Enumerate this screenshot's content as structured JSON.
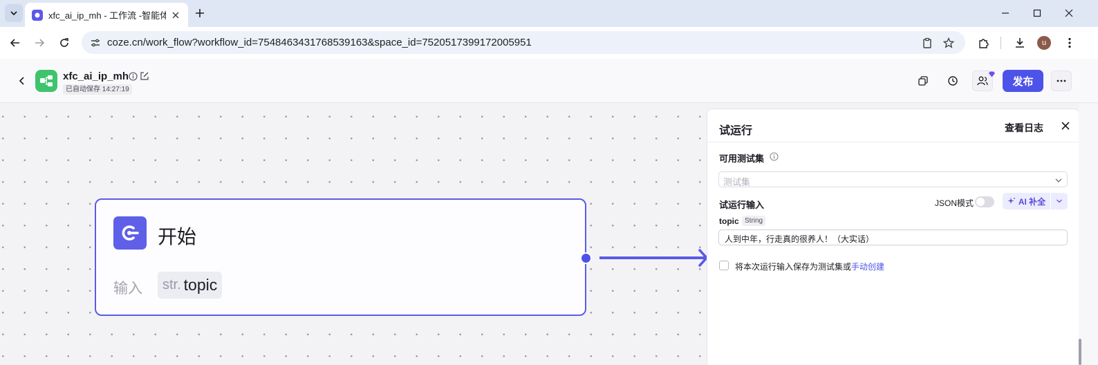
{
  "browser": {
    "tab_title": "xfc_ai_ip_mh - 工作流 -智能体",
    "url": "coze.cn/work_flow?workflow_id=7548463431768539163&space_id=7520517399172005951",
    "avatar_letter": "u"
  },
  "header": {
    "workflow_name": "xfc_ai_ip_mh",
    "autosave": "已自动保存 14:27:19",
    "publish_label": "发布"
  },
  "canvas": {
    "start_node": {
      "title": "开始",
      "input_label": "输入",
      "param_type": "str.",
      "param_name": "topic"
    }
  },
  "test_panel": {
    "title": "试运行",
    "view_logs": "查看日志",
    "available_sets_label": "可用测试集",
    "testset_placeholder": "测试集",
    "run_input_label": "试运行输入",
    "json_mode_label": "JSON模式",
    "json_mode_on": false,
    "ai_complete_label": "AI 补全",
    "field": {
      "name": "topic",
      "type": "String",
      "value": "人到中年，行走真的很养人！（大实话）"
    },
    "save_text": "将本次运行输入保存为测试集或",
    "save_link": "手动创建"
  },
  "colors": {
    "accent": "#4d53e8",
    "workflow_icon": "#3ec46d"
  }
}
